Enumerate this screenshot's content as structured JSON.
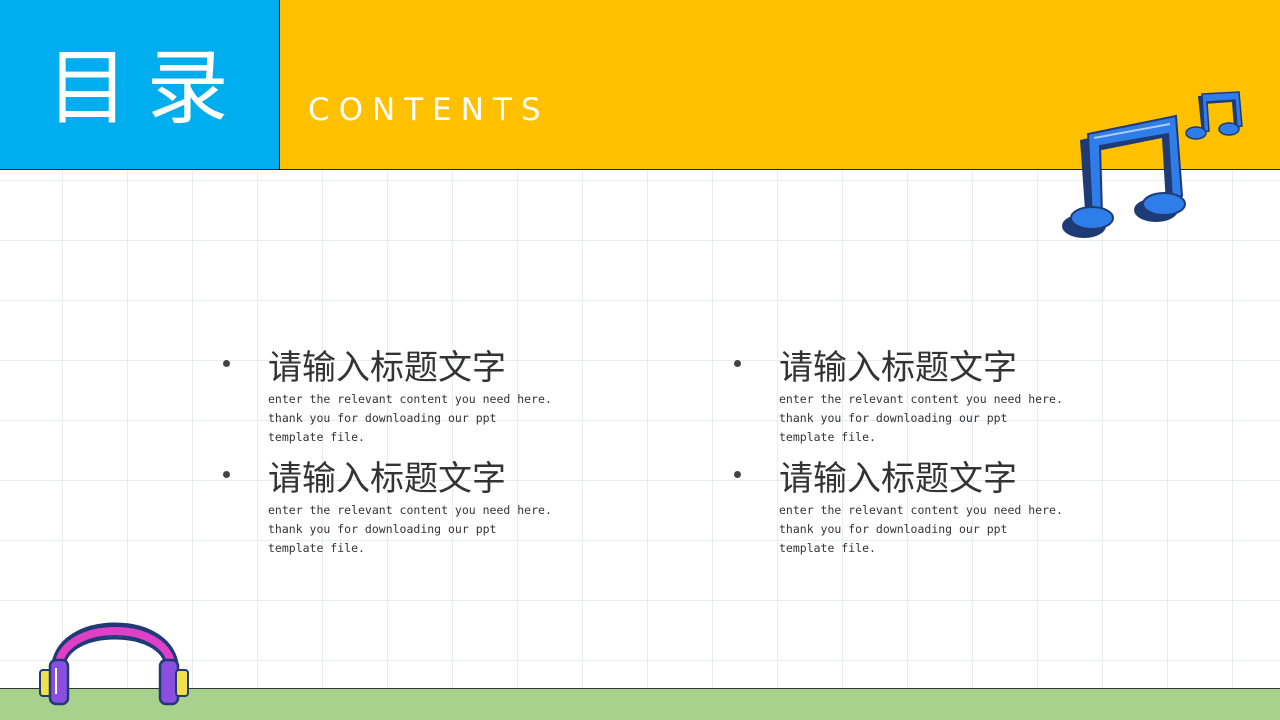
{
  "header": {
    "title": "目录",
    "subtitle": "CONTENTS"
  },
  "colors": {
    "title_box": "#00adef",
    "band": "#ffc000",
    "footer": "#a9d18e",
    "note_blue": "#2f7de8",
    "note_dark": "#1f3b77"
  },
  "icons": [
    "music-notes-icon",
    "headphones-icon"
  ],
  "items": [
    {
      "title": "请输入标题文字",
      "desc": "enter the relevant content you need here. thank you for downloading our ppt template file."
    },
    {
      "title": "请输入标题文字",
      "desc": "enter the relevant content you need here. thank you for downloading our ppt template file."
    },
    {
      "title": "请输入标题文字",
      "desc": "enter the relevant content you need here. thank you for downloading our ppt template file."
    },
    {
      "title": "请输入标题文字",
      "desc": "enter the relevant content you need here. thank you for downloading our ppt template file."
    }
  ]
}
